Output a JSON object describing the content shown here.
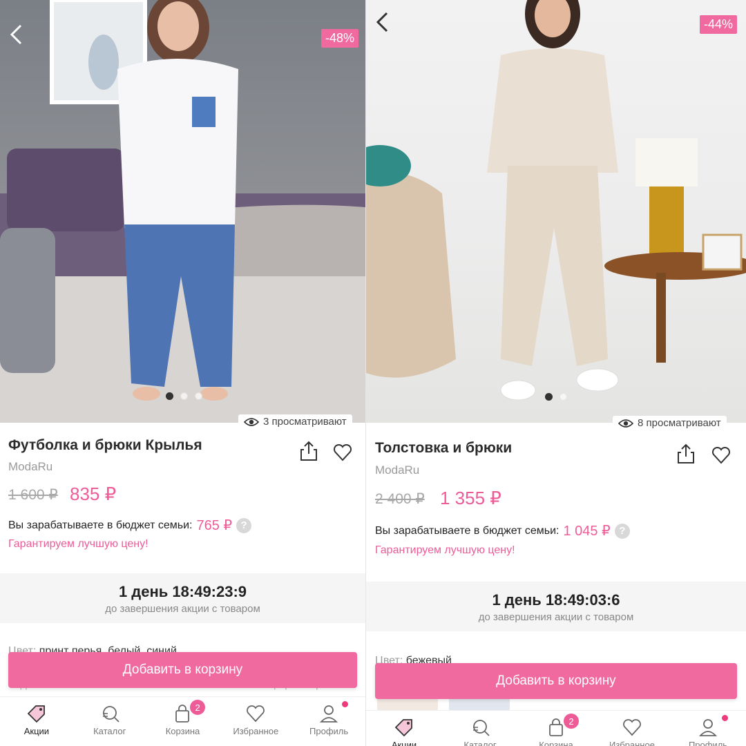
{
  "left": {
    "discount_badge": "-48%",
    "viewers": "3 просматривают",
    "title": "Футболка и брюки Крылья",
    "brand": "ModaRu",
    "old_price": "1 600 ₽",
    "new_price": "835 ₽",
    "earn_label": "Вы зарабатываете в бюджет семьи:",
    "earn_value": "765 ₽",
    "help": "?",
    "guarantee": "Гарантируем лучшую цену!",
    "timer": "1 день 18:49:23:9",
    "timer_sub": "до завершения акции с товаром",
    "color_key": "Цвет:",
    "color_value": "принт перья, белый, синий",
    "country_value": "Сделано в России",
    "size_table": "Таблица размеров",
    "cart_button": "Добавить в корзину",
    "image_dots": 3
  },
  "right": {
    "discount_badge": "-44%",
    "viewers": "8 просматривают",
    "title": "Толстовка и брюки",
    "brand": "ModaRu",
    "old_price": "2 400 ₽",
    "new_price": "1 355 ₽",
    "earn_label": "Вы зарабатываете в бюджет семьи:",
    "earn_value": "1 045 ₽",
    "help": "?",
    "guarantee": "Гарантируем лучшую цену!",
    "timer": "1 день 18:49:03:6",
    "timer_sub": "до завершения акции с товаром",
    "color_key": "Цвет:",
    "color_value": "бежевый",
    "cart_button": "Добавить в корзину",
    "image_dots": 2
  },
  "tabbar": {
    "items": [
      {
        "label": "Акции",
        "icon": "tag-icon",
        "active": true
      },
      {
        "label": "Каталог",
        "icon": "catalog-search-icon"
      },
      {
        "label": "Корзина",
        "icon": "bag-icon",
        "badge": "2"
      },
      {
        "label": "Избранное",
        "icon": "heart-icon"
      },
      {
        "label": "Профиль",
        "icon": "profile-icon",
        "notify_dot": true
      }
    ]
  },
  "colors": {
    "accent": "#ee5c98",
    "button": "#f06aa0",
    "muted": "#a7a7a7"
  }
}
